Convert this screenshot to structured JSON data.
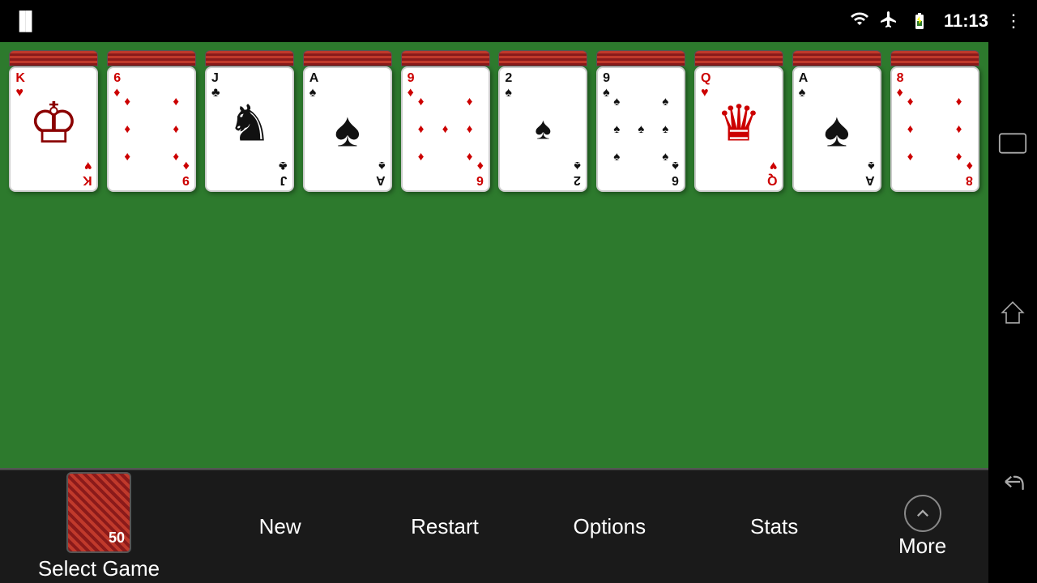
{
  "statusBar": {
    "time": "11:13",
    "leftIcon": "|||"
  },
  "cards": [
    {
      "id": "col1",
      "rank": "K",
      "suit": "♥",
      "color": "red",
      "type": "king",
      "centerDisplay": "👑",
      "bottomRank": "K"
    },
    {
      "id": "col2",
      "rank": "6",
      "suit": "♦",
      "color": "red",
      "type": "number",
      "bottomRank": "6"
    },
    {
      "id": "col3",
      "rank": "J",
      "suit": "♣",
      "color": "black",
      "type": "jack",
      "bottomRank": "J"
    },
    {
      "id": "col4",
      "rank": "A",
      "suit": "♠",
      "color": "black",
      "type": "ace",
      "bottomRank": "A"
    },
    {
      "id": "col5",
      "rank": "9",
      "suit": "♦",
      "color": "red",
      "type": "nine",
      "bottomRank": "6"
    },
    {
      "id": "col6",
      "rank": "2",
      "suit": "♠",
      "color": "black",
      "type": "number",
      "bottomRank": "2"
    },
    {
      "id": "col7",
      "rank": "9",
      "suit": "♠",
      "color": "black",
      "type": "nine-spades",
      "bottomRank": "6"
    },
    {
      "id": "col8",
      "rank": "Q",
      "suit": "♥",
      "color": "red",
      "type": "queen",
      "bottomRank": "Q"
    },
    {
      "id": "col9",
      "rank": "A",
      "suit": "♠",
      "color": "black",
      "type": "ace",
      "bottomRank": "A"
    },
    {
      "id": "col10",
      "rank": "8",
      "suit": "♦",
      "color": "red",
      "type": "number",
      "bottomRank": "8"
    }
  ],
  "toolbar": {
    "selectGame": "Select Game",
    "gameNumber": "50",
    "new": "New",
    "restart": "Restart",
    "options": "Options",
    "stats": "Stats",
    "more": "More"
  },
  "navButtons": {
    "landscape": "⬜",
    "home": "⌂",
    "back": "↩"
  }
}
